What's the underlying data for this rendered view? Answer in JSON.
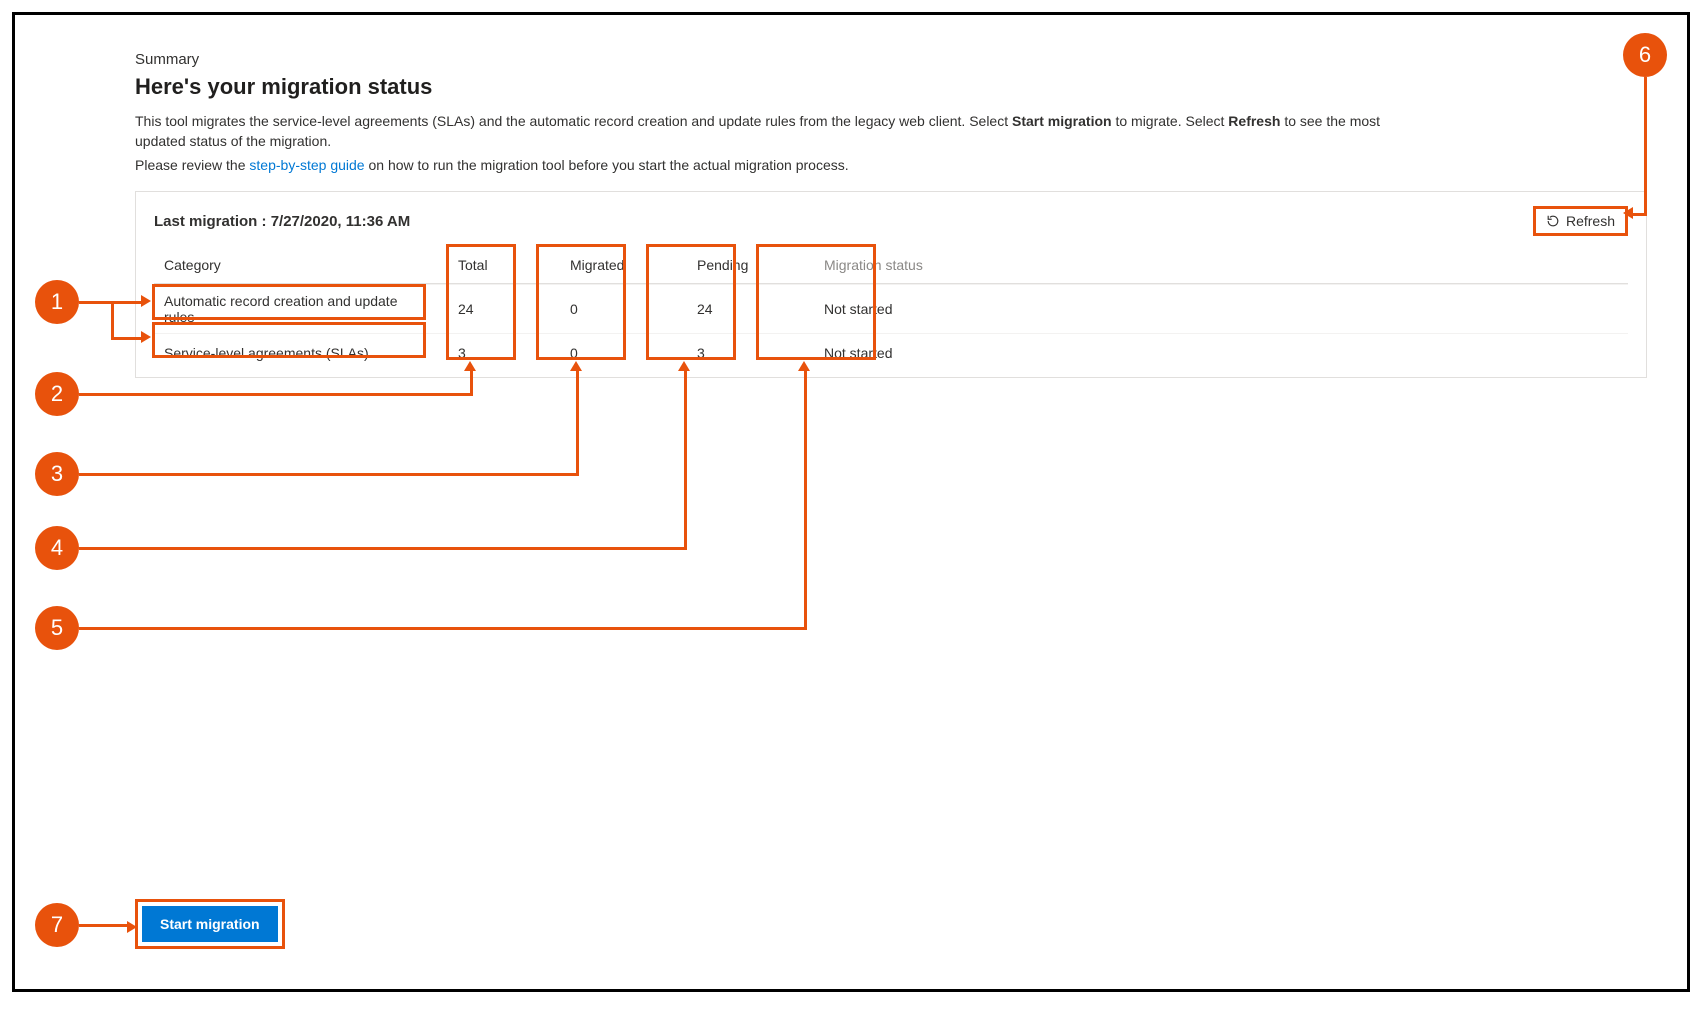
{
  "summary_label": "Summary",
  "page_title": "Here's your migration status",
  "description": {
    "prefix": "This tool migrates the service-level agreements (SLAs) and the automatic record creation and update rules from the legacy web client. Select ",
    "bold1": "Start migration",
    "mid": " to migrate. Select ",
    "bold2": "Refresh",
    "suffix": " to see the most updated status of the migration."
  },
  "guide_line": {
    "prefix": "Please review the ",
    "link_text": "step-by-step guide",
    "suffix": " on how to run the migration tool before you start the actual migration process."
  },
  "last_migration_label": "Last migration :",
  "last_migration_value": "7/27/2020, 11:36 AM",
  "refresh_label": "Refresh",
  "columns": {
    "category": "Category",
    "total": "Total",
    "migrated": "Migrated",
    "pending": "Pending",
    "status": "Migration status"
  },
  "rows": [
    {
      "category": "Automatic record creation and update rules",
      "total": "24",
      "migrated": "0",
      "pending": "24",
      "status": "Not started"
    },
    {
      "category": "Service-level agreements (SLAs)",
      "total": "3",
      "migrated": "0",
      "pending": "3",
      "status": "Not started"
    }
  ],
  "start_migration_label": "Start migration",
  "callouts": [
    "1",
    "2",
    "3",
    "4",
    "5",
    "6",
    "7"
  ]
}
